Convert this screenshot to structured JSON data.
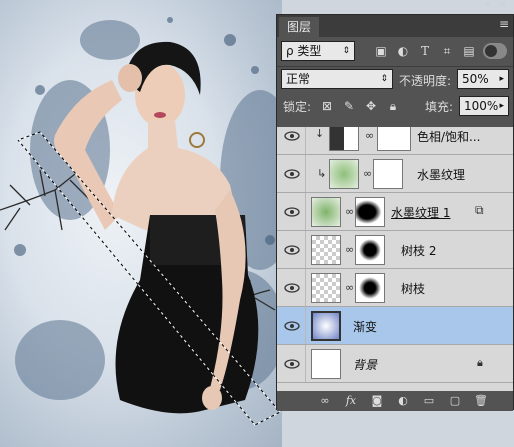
{
  "panel": {
    "tab_label": "图层",
    "menu_icon": "panel-menu-icon",
    "filter": {
      "label": "ρ 类型",
      "icons": [
        "image-filter-icon",
        "adjustment-filter-icon",
        "text-filter-icon",
        "shape-filter-icon",
        "smart-object-filter-icon"
      ]
    },
    "blend_mode": "正常",
    "opacity_label": "不透明度:",
    "opacity_value": "50%",
    "lock_label": "锁定:",
    "fill_label": "填充:",
    "fill_value": "100%",
    "lock_icons": [
      "lock-transparency-icon",
      "lock-image-icon",
      "lock-position-icon",
      "lock-all-icon"
    ]
  },
  "layers": [
    {
      "name": "色相/饱和...",
      "type": "adjustment",
      "clipped": true,
      "selected": false
    },
    {
      "name": "水墨纹理",
      "type": "clipped-image",
      "clipped": true,
      "selected": false
    },
    {
      "name": "水墨纹理 1",
      "type": "masked",
      "clipped": false,
      "selected": false,
      "underline": true
    },
    {
      "name": "树枝 2",
      "type": "masked",
      "clipped": false,
      "selected": false
    },
    {
      "name": "树枝",
      "type": "masked",
      "clipped": false,
      "selected": false
    },
    {
      "name": "渐变",
      "type": "gradient",
      "clipped": false,
      "selected": true
    },
    {
      "name": "背景",
      "type": "background",
      "clipped": false,
      "selected": false,
      "locked": true
    }
  ],
  "footer_icons": [
    "link-layers-icon",
    "fx-icon",
    "add-mask-icon",
    "adjustment-layer-icon",
    "new-group-icon",
    "new-layer-icon",
    "delete-layer-icon"
  ],
  "colors": {
    "panel_bg": "#535353",
    "selected": "#a8c7ea",
    "layer_bg": "#d8d8d8"
  }
}
